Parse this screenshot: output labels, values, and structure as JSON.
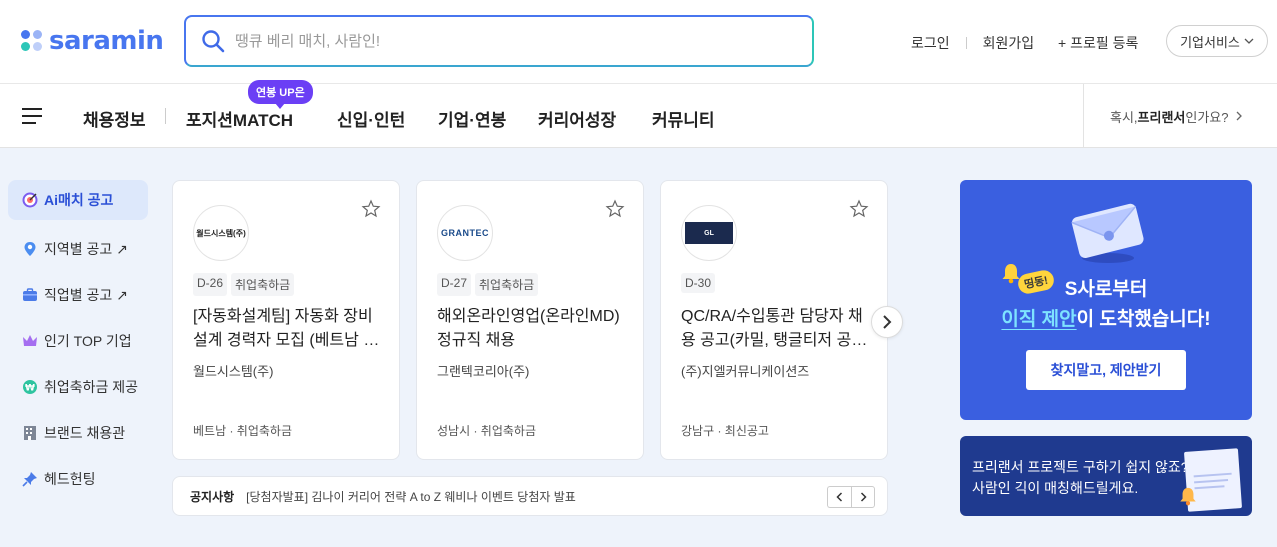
{
  "brand": {
    "name": "saramin",
    "accent": "#4876ef",
    "teal": "#2dc6b8"
  },
  "search": {
    "placeholder": "땡큐 베리 매치, 사람인!"
  },
  "header_links": {
    "login": "로그인",
    "signup": "회원가입",
    "profile": "+ 프로필 등록",
    "business": "기업서비스"
  },
  "nav": {
    "items": [
      "채용정보",
      "포지션MATCH",
      "신입·인턴",
      "기업·연봉",
      "커리어성장",
      "커뮤니티"
    ],
    "badge": "연봉 UP은",
    "freelancer_prefix": "혹시, ",
    "freelancer_bold": "프리랜서",
    "freelancer_suffix": "인가요?"
  },
  "sidebar": [
    {
      "label": "Ai매치 공고",
      "icon": "target-icon",
      "active": true
    },
    {
      "label": "지역별 공고 ↗",
      "icon": "map-pin-icon"
    },
    {
      "label": "직업별 공고 ↗",
      "icon": "briefcase-icon"
    },
    {
      "label": "인기 TOP 기업",
      "icon": "crown-icon"
    },
    {
      "label": "취업축하금 제공",
      "icon": "won-coin-icon"
    },
    {
      "label": "브랜드 채용관",
      "icon": "building-icon"
    },
    {
      "label": "헤드헌팅",
      "icon": "pin-icon"
    }
  ],
  "cards": [
    {
      "logo": "월드시스템(주)",
      "dday": "D-26",
      "tag": "취업축하금",
      "title": "[자동화설계팀] 자동화 장비 설계 경력자 모집 (베트남 상주)",
      "company": "월드시스템(주)",
      "location": "베트남 · 취업축하금"
    },
    {
      "logo": "GRANTEC",
      "dday": "D-27",
      "tag": "취업축하금",
      "title": "해외온라인영업(온라인MD) 정규직 채용",
      "company": "그랜텍코리아(주)",
      "location": "성남시 · 취업축하금"
    },
    {
      "logo": "GL",
      "dday": "D-30",
      "tag": "",
      "title": "QC/RA/수입통관 담당자 채용 공고(카밀, 탱글티저 공식 수입사)",
      "company": "(주)지엘커뮤니케이션즈",
      "location": "강남구 · 최신공고"
    }
  ],
  "notice": {
    "label": "공지사항",
    "text": "[당첨자발표] 김나이 커리어 전략 A to Z 웨비나 이벤트 당첨자 발표"
  },
  "banner1": {
    "badge": "띵동!",
    "line1": "S사로부터",
    "line2_hl": "이직 제안",
    "line2_rest": "이 도착했습니다!",
    "cta": "찾지말고, 제안받기"
  },
  "banner2": {
    "line1": "프리랜서 프로젝트 구하기 쉽지 않죠?",
    "line2": "사람인 긱이 매칭해드릴게요."
  }
}
